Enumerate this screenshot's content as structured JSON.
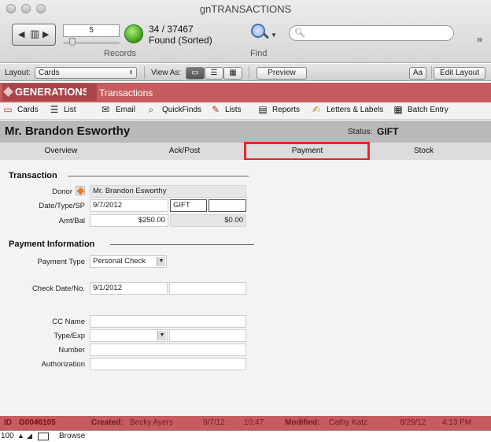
{
  "window": {
    "title": "gnTRANSACTIONS"
  },
  "records": {
    "current": "5",
    "count": "34 / 37467",
    "found": "Found (Sorted)",
    "label": "Records"
  },
  "find": {
    "label": "Find",
    "search_placeholder": ""
  },
  "layoutbar": {
    "layout_label": "Layout:",
    "layout_value": "Cards",
    "viewas_label": "View As:",
    "preview": "Preview",
    "font_button": "Aa",
    "edit_layout": "Edit Layout"
  },
  "brand": {
    "logo": "GENERATIONS",
    "section": "Transactions"
  },
  "nav": {
    "cards": "Cards",
    "list": "List",
    "email": "Email",
    "quickfinds": "QuickFinds",
    "lists": "Lists",
    "reports": "Reports",
    "letters": "Letters & Labels",
    "batch": "Batch Entry"
  },
  "record": {
    "name": "Mr. Brandon Esworthy",
    "status_label": "Status:",
    "status_value": "GIFT"
  },
  "tabs": {
    "overview": "Overview",
    "ackpost": "Ack/Post",
    "payment": "Payment",
    "stock": "Stock"
  },
  "transaction": {
    "heading": "Transaction",
    "donor_label": "Donor",
    "donor_value": "Mr. Brandon Esworthy",
    "dts_label": "Date/Type/SP",
    "date_value": "9/7/2012",
    "type_value": "GIFT",
    "sp_value": "",
    "amt_label": "Amt/Bal",
    "amount_value": "$250.00",
    "balance_value": "$0.00"
  },
  "payment": {
    "heading": "Payment Information",
    "type_label": "Payment Type",
    "type_value": "Personal Check",
    "check_label": "Check Date/No.",
    "check_date": "9/1/2012",
    "check_no": "",
    "cc_name_label": "CC Name",
    "cc_name": "",
    "type_exp_label": "Type/Exp",
    "cc_type": "",
    "cc_exp": "",
    "number_label": "Number",
    "number": "",
    "auth_label": "Authorization",
    "authorization": ""
  },
  "footer": {
    "id_label": "ID",
    "id_value": "G0046105",
    "created_label": "Created:",
    "created_by": "Becky Ayers",
    "created_date": "9/7/12",
    "created_time": "10:47",
    "modified_label": "Modified:",
    "modified_by": "Cathy Katz",
    "modified_date": "8/29/12",
    "modified_time": "4:13 PM"
  },
  "statusbar": {
    "zoom": "100",
    "mode": "Browse"
  }
}
